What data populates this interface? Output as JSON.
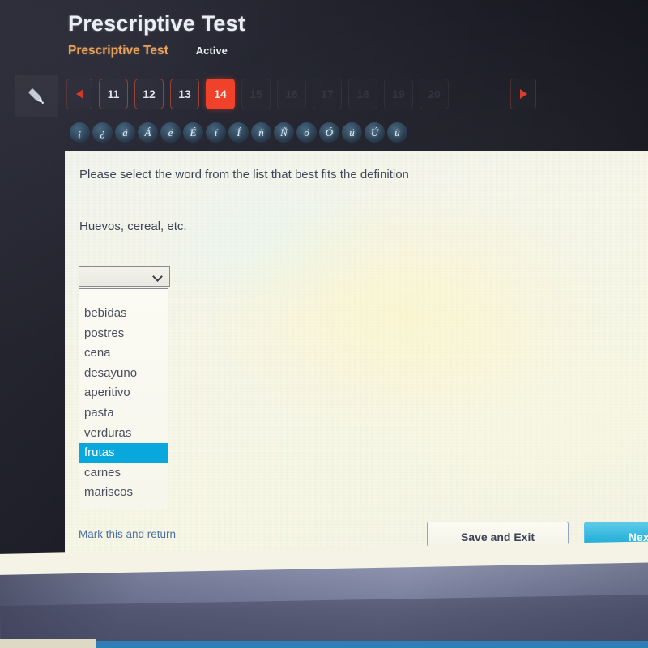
{
  "header": {
    "app_title": "Prescriptive Test",
    "sub_title": "Prescriptive Test",
    "status": "Active"
  },
  "toolbar": {
    "pencil_icon": "pencil-icon",
    "prev_label": "◀",
    "next_label": "▶",
    "questions": [
      {
        "number": "11",
        "state": "normal"
      },
      {
        "number": "12",
        "state": "normal"
      },
      {
        "number": "13",
        "state": "normal"
      },
      {
        "number": "14",
        "state": "active"
      },
      {
        "number": "15",
        "state": "dim"
      },
      {
        "number": "16",
        "state": "dim"
      },
      {
        "number": "17",
        "state": "dim"
      },
      {
        "number": "18",
        "state": "dim"
      },
      {
        "number": "19",
        "state": "dim"
      },
      {
        "number": "20",
        "state": "dim"
      }
    ]
  },
  "accent_bar": {
    "chars": [
      "¡",
      "¿",
      "á",
      "Á",
      "é",
      "É",
      "í",
      "Í",
      "ñ",
      "Ñ",
      "ó",
      "Ó",
      "ú",
      "Ú",
      "ü"
    ]
  },
  "question": {
    "prompt": "Please select the word from the list that best fits the definition",
    "definition": "Huevos, cereal, etc.",
    "select_value": "",
    "options": [
      "bebidas",
      "postres",
      "cena",
      "desayuno",
      "aperitivo",
      "pasta",
      "verduras",
      "frutas",
      "carnes",
      "mariscos"
    ],
    "selected_option": "frutas"
  },
  "footer": {
    "mark_link": "Mark this and return",
    "save_label": "Save and Exit",
    "next_label": "Next"
  },
  "colors": {
    "accent_orange": "#f0422a",
    "sub_title_orange": "#e7a15c",
    "highlight_blue": "#08a7dc",
    "next_button": "#2fb4dc",
    "link_blue": "#4d6fa3"
  }
}
